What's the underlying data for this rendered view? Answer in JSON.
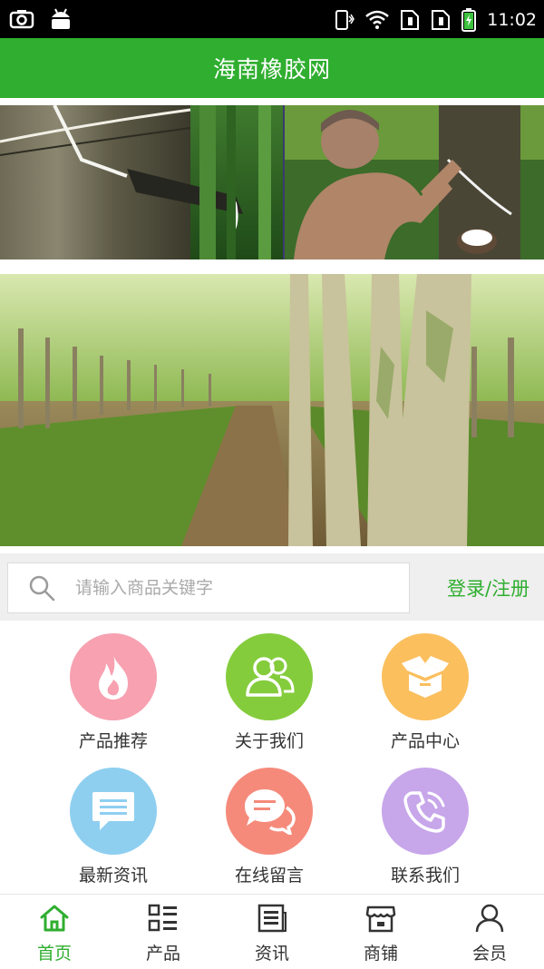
{
  "status_bar": {
    "time": "11:02",
    "icons": [
      "screenshot-icon",
      "android-icon",
      "phone-vibrate-icon",
      "wifi-icon",
      "sim1-icon",
      "sim2-icon",
      "battery-icon"
    ]
  },
  "header": {
    "title": "海南橡胶网"
  },
  "banners": {
    "top_images": [
      "rubber-tapping-tree-photo",
      "rubber-tapper-man-photo"
    ],
    "main_image": "rubber-plantation-photo",
    "carousel": {
      "count": 3,
      "active_index": 2
    }
  },
  "search": {
    "placeholder": "请输入商品关键字",
    "value": "",
    "login_label": "登录/注册"
  },
  "menu": {
    "items": [
      {
        "label": "产品推荐",
        "icon": "flame-icon",
        "color": "#f7a1b1"
      },
      {
        "label": "关于我们",
        "icon": "users-icon",
        "color": "#84cc3c"
      },
      {
        "label": "产品中心",
        "icon": "box-icon",
        "color": "#fbbf5e"
      },
      {
        "label": "最新资讯",
        "icon": "message-icon",
        "color": "#8ecff0"
      },
      {
        "label": "在线留言",
        "icon": "chat-bubbles-icon",
        "color": "#f58a7b"
      },
      {
        "label": "联系我们",
        "icon": "phone-icon",
        "color": "#c7a6ea"
      }
    ]
  },
  "tabbar": {
    "items": [
      {
        "label": "首页",
        "icon": "home-icon",
        "active": true
      },
      {
        "label": "产品",
        "icon": "list-grid-icon",
        "active": false
      },
      {
        "label": "资讯",
        "icon": "news-icon",
        "active": false
      },
      {
        "label": "商铺",
        "icon": "store-icon",
        "active": false
      },
      {
        "label": "会员",
        "icon": "user-icon",
        "active": false
      }
    ],
    "active_color": "#2fae2f"
  },
  "colors": {
    "brand_green": "#2fae2f",
    "carousel_active": "#e01010"
  }
}
